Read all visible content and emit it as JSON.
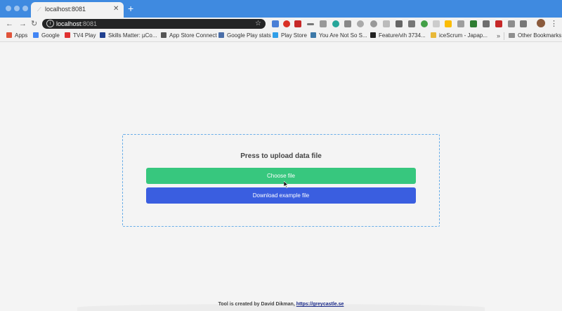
{
  "browser": {
    "tab": {
      "title": "localhost:8081"
    },
    "address": {
      "host": "localhost",
      "port": ":8081"
    },
    "bookmarks": [
      {
        "label": "Apps",
        "icon": "apps-grid-icon",
        "color": "#e0533a"
      },
      {
        "label": "Google",
        "icon": "google-icon",
        "color": "#4285f4"
      },
      {
        "label": "TV4 Play",
        "icon": "tv4-icon",
        "color": "#e03131"
      },
      {
        "label": "Skills Matter: µCo...",
        "icon": "skills-matter-icon",
        "color": "#1f3f8f"
      },
      {
        "label": "App Store Connect",
        "icon": "apple-icon",
        "color": "#555555"
      },
      {
        "label": "Google Play stats",
        "icon": "google-play-stats-icon",
        "color": "#4a6ea8"
      },
      {
        "label": "Play Store",
        "icon": "play-store-icon",
        "color": "#2f9ee8"
      },
      {
        "label": "You Are Not So S...",
        "icon": "wordpress-icon",
        "color": "#3c78a8"
      },
      {
        "label": "Feature/vih 3734...",
        "icon": "github-icon",
        "color": "#222222"
      },
      {
        "label": "iceScrum - Japap...",
        "icon": "icescrum-icon",
        "color": "#e8b838"
      }
    ],
    "bookmarks_more": "»",
    "other_bookmarks": "Other Bookmarks"
  },
  "page": {
    "upload_title": "Press to upload data file",
    "choose_button": "Choose file",
    "download_button": "Download example file",
    "footer_text": "Tool is created by David Dikman, ",
    "footer_link": "https://greycastle.se"
  },
  "colors": {
    "choose": "#37c77e",
    "download": "#3a5ee0",
    "dropzone_border": "#6aaee8"
  }
}
